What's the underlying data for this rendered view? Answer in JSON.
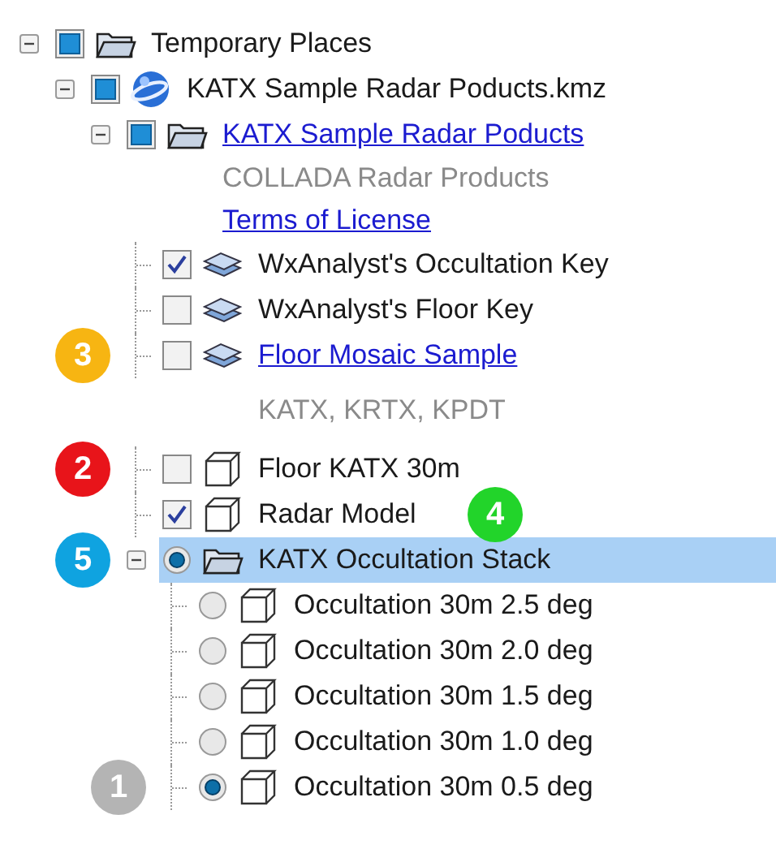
{
  "tree": [
    {
      "label": "Temporary Places",
      "link": false,
      "kind": "folder",
      "check": {
        "kind": "full"
      },
      "expanded": true,
      "selected": false,
      "children": [
        {
          "label": "KATX Sample Radar Poducts.kmz",
          "link": false,
          "kind": "globe",
          "check": {
            "kind": "full"
          },
          "expanded": true,
          "selected": false,
          "children": [
            {
              "label": "KATX Sample Radar Poducts",
              "link": true,
              "kind": "folder",
              "check": {
                "kind": "full"
              },
              "expanded": true,
              "selected": false,
              "notes": [
                {
                  "text": "COLLADA Radar Products",
                  "link": false
                },
                {
                  "text": "Terms of License",
                  "link": true
                }
              ],
              "children": [
                {
                  "label": "WxAnalyst's Occultation Key",
                  "link": false,
                  "kind": "layers",
                  "check": {
                    "kind": "box",
                    "checked": true
                  },
                  "selected": false
                },
                {
                  "label": "WxAnalyst's Floor Key",
                  "link": false,
                  "kind": "layers",
                  "check": {
                    "kind": "box",
                    "checked": false
                  },
                  "selected": false
                },
                {
                  "label": "Floor Mosaic Sample",
                  "link": true,
                  "kind": "layers",
                  "check": {
                    "kind": "box",
                    "checked": false
                  },
                  "selected": false,
                  "callout": {
                    "label": "3",
                    "color": "#f7b512",
                    "kind": "left"
                  },
                  "notes": [
                    {
                      "text": "KATX, KRTX, KPDT",
                      "link": false
                    }
                  ]
                },
                {
                  "label": "Floor KATX 30m",
                  "link": false,
                  "kind": "model",
                  "check": {
                    "kind": "box",
                    "checked": false
                  },
                  "selected": false,
                  "callout": {
                    "label": "2",
                    "color": "#e8141a",
                    "kind": "left"
                  }
                },
                {
                  "label": "Radar Model",
                  "link": false,
                  "kind": "model",
                  "check": {
                    "kind": "box",
                    "checked": true
                  },
                  "selected": false,
                  "callout": {
                    "label": "4",
                    "color": "#22d42a",
                    "kind": "right"
                  }
                },
                {
                  "label": "KATX Occultation Stack",
                  "link": false,
                  "kind": "folder",
                  "check": {
                    "kind": "radio",
                    "checked": true
                  },
                  "expanded": true,
                  "selected": true,
                  "callout": {
                    "label": "5",
                    "color": "#0fa3e0",
                    "kind": "left"
                  },
                  "children": [
                    {
                      "label": "Occultation 30m 2.5 deg",
                      "link": false,
                      "kind": "model",
                      "check": {
                        "kind": "radio",
                        "checked": false
                      },
                      "selected": false
                    },
                    {
                      "label": "Occultation 30m 2.0 deg",
                      "link": false,
                      "kind": "model",
                      "check": {
                        "kind": "radio",
                        "checked": false
                      },
                      "selected": false
                    },
                    {
                      "label": "Occultation 30m 1.5 deg",
                      "link": false,
                      "kind": "model",
                      "check": {
                        "kind": "radio",
                        "checked": false
                      },
                      "selected": false
                    },
                    {
                      "label": "Occultation 30m 1.0 deg",
                      "link": false,
                      "kind": "model",
                      "check": {
                        "kind": "radio",
                        "checked": false
                      },
                      "selected": false
                    },
                    {
                      "label": "Occultation 30m 0.5 deg",
                      "link": false,
                      "kind": "model",
                      "check": {
                        "kind": "radio",
                        "checked": true
                      },
                      "selected": false,
                      "callout": {
                        "label": "1",
                        "color": "#b4b4b4",
                        "kind": "left"
                      }
                    }
                  ]
                }
              ]
            }
          ]
        }
      ]
    }
  ]
}
